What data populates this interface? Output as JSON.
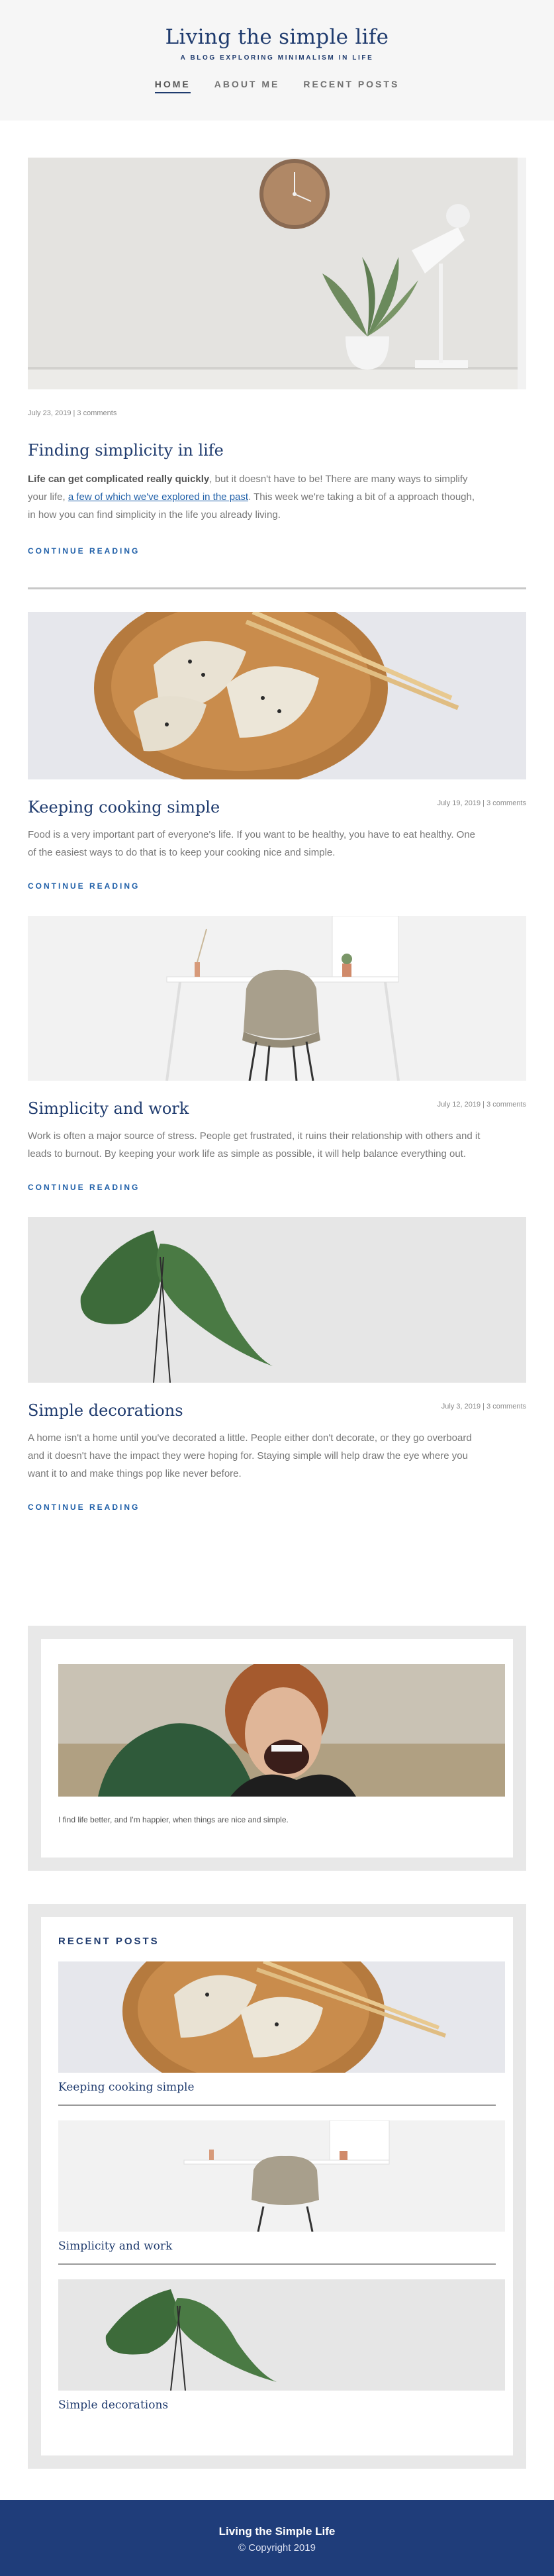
{
  "site": {
    "title": "Living the simple life",
    "subtitle": "A BLOG EXPLORING MINIMALISM IN LIFE"
  },
  "nav": [
    {
      "label": "HOME",
      "active": true
    },
    {
      "label": "ABOUT ME",
      "active": false
    },
    {
      "label": "RECENT POSTS",
      "active": false
    }
  ],
  "posts": [
    {
      "meta": "July 23, 2019 | 3 comments",
      "title": "Finding simplicity in life",
      "excerpt_bold": "Life can get complicated really quickly",
      "excerpt_a": ", but it doesn't have to be! There are many ways to simplify your life, ",
      "excerpt_link": "a few of which we've explored in the past",
      "excerpt_b": ". This week we're taking a bit of a approach though, in how you can find simplicity in the life you already living.",
      "read_more": "CONTINUE READING"
    },
    {
      "meta": "July 19, 2019 | 3 comments",
      "title": "Keeping cooking simple",
      "excerpt": "Food is a very important part of everyone's life. If you want to be healthy, you have to eat healthy. One of the easiest ways to do that is to keep your cooking nice and simple.",
      "read_more": "CONTINUE READING"
    },
    {
      "meta": "July 12, 2019 | 3 comments",
      "title": "Simplicity and work",
      "excerpt": "Work is often a major source of stress. People get frustrated, it ruins their relationship with others and it leads to burnout. By keeping your work life as simple as possible, it will help balance everything out.",
      "read_more": "CONTINUE READING"
    },
    {
      "meta": "July 3, 2019 | 3 comments",
      "title": "Simple decorations",
      "excerpt": "A home isn't a home until you've decorated a little. People either don't decorate, or they go overboard and it doesn't have the impact they were hoping for. Staying simple will help draw the eye where you want it to and make things pop like never before.",
      "read_more": "CONTINUE READING"
    }
  ],
  "about_widget": {
    "caption": "I find life better, and I'm happier, when things are nice and simple."
  },
  "recent_posts": {
    "title": "RECENT POSTS",
    "items": [
      {
        "title": "Keeping cooking simple"
      },
      {
        "title": "Simplicity and work"
      },
      {
        "title": "Simple decorations"
      }
    ]
  },
  "footer": {
    "title": "Living the Simple Life",
    "copyright": "© Copyright 2019"
  },
  "colors": {
    "brand": "#1f3b6e",
    "link": "#1f5fa8",
    "footer_bg": "#1f3d7a"
  }
}
